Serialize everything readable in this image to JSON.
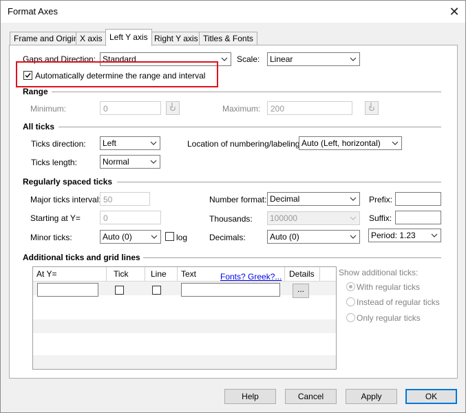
{
  "window": {
    "title": "Format Axes",
    "close_glyph": "✕"
  },
  "tabs": [
    {
      "label": "Frame and Origin"
    },
    {
      "label": "X axis"
    },
    {
      "label": "Left Y axis"
    },
    {
      "label": "Right Y axis"
    },
    {
      "label": "Titles & Fonts"
    }
  ],
  "top": {
    "gaps_label": "Gaps and Direction:",
    "gaps_value": "Standard",
    "scale_label": "Scale:",
    "scale_value": "Linear",
    "auto_label": "Automatically determine the range and interval",
    "auto_checked": true
  },
  "range": {
    "header": "Range",
    "min_label": "Minimum:",
    "min_value": "0",
    "max_label": "Maximum:",
    "max_value": "200",
    "pick_icon": "pointer-icon"
  },
  "all_ticks": {
    "header": "All ticks",
    "direction_label": "Ticks direction:",
    "direction_value": "Left",
    "length_label": "Ticks length:",
    "length_value": "Normal",
    "location_label": "Location of numbering/labeling:",
    "location_value": "Auto (Left, horizontal)"
  },
  "regular": {
    "header": "Regularly spaced ticks",
    "major_label": "Major ticks interval:",
    "major_value": "50",
    "start_label": "Starting at Y=",
    "start_value": "0",
    "minor_label": "Minor ticks:",
    "minor_value": "Auto (0)",
    "log_label": "log",
    "numformat_label": "Number format:",
    "numformat_value": "Decimal",
    "thousands_label": "Thousands:",
    "thousands_value": "100000",
    "decimals_label": "Decimals:",
    "decimals_value": "Auto (0)",
    "prefix_label": "Prefix:",
    "suffix_label": "Suffix:",
    "period_value": "Period: 1.23"
  },
  "additional": {
    "header": "Additional ticks and grid lines",
    "columns": [
      "At Y=",
      "Tick",
      "Line",
      "Text",
      "Details"
    ],
    "fonts_link": "Fonts? Greek?...",
    "details_btn": "...",
    "show_label": "Show additional ticks:",
    "options": [
      "With regular ticks",
      "Instead of regular ticks",
      "Only regular ticks"
    ],
    "selected_option": 0
  },
  "buttons": {
    "help": "Help",
    "cancel": "Cancel",
    "apply": "Apply",
    "ok": "OK"
  },
  "colors": {
    "highlight_box": "#e0101a",
    "default_button": "#0078d7",
    "link": "#0000ee"
  }
}
